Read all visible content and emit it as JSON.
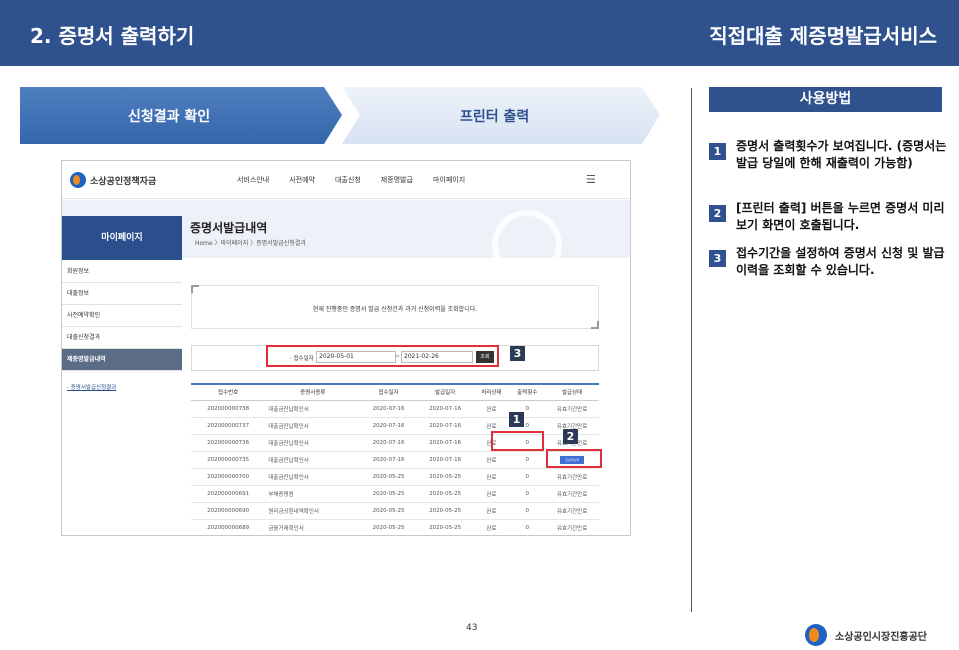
{
  "header": {
    "title_left": "2. 증명서 출력하기",
    "title_right": "직접대출 제증명발급서비스"
  },
  "steps": [
    "신청결과 확인",
    "프린터 출력"
  ],
  "howto": {
    "title": "사용방법",
    "tips": [
      {
        "num": "1",
        "text": "증명서 출력횟수가 보여집니다. (증명서는 발급 당일에 한해 재출력이 가능함)"
      },
      {
        "num": "2",
        "text": "[프린터 출력] 버튼을 누르면 증명서 미리보기 화면이 호출됩니다."
      },
      {
        "num": "3",
        "text": "접수기간을 설정하여 증명서 신청 및 발급이력을 조회할 수 있습니다."
      }
    ]
  },
  "site": {
    "logo_text": "소상공인정책자금",
    "nav": [
      "서비스안내",
      "사전예약",
      "대출신청",
      "제증명발급",
      "마이페이지"
    ],
    "page_title": "증명서발급내역",
    "breadcrumb": "Home 〉마이페이지 〉증명서발급신청결과",
    "sidebar_head": "마이페이지",
    "sidebar_items": [
      "회원정보",
      "대출정보",
      "사전예약확인",
      "대출신청결과",
      "제증명발급내역"
    ],
    "sidebar_sub": "- 증명서발급신청결과",
    "notice": "현재 진행중인 증명서 발급 신청건과 과거 신청이력을 조회합니다.",
    "search": {
      "label": "· 접수일자",
      "from": "2020-05-01",
      "sep": "~",
      "to": "2021-02-26",
      "button": "조회"
    },
    "table": {
      "headers": [
        "접수번호",
        "증명서종류",
        "접수일자",
        "발급일자",
        "처리상태",
        "출력횟수",
        "발급상태"
      ],
      "rows": [
        [
          "202000000738",
          "대출금잔납확인서",
          "2020-07-16",
          "2020-07-16",
          "완료",
          "0",
          "유효기간만료"
        ],
        [
          "202000000737",
          "대출금잔납확인서",
          "2020-07-16",
          "2020-07-16",
          "완료",
          "0",
          "유효기간만료"
        ],
        [
          "202000000736",
          "대출금잔납확인서",
          "2020-07-16",
          "2020-07-16",
          "완료",
          "0",
          "유효기간만료"
        ],
        [
          "202000000735",
          "대출금잔납확인서",
          "2020-07-16",
          "2020-07-16",
          "완료",
          "0",
          "프린터출력"
        ],
        [
          "202000000700",
          "대출금잔납확인서",
          "2020-05-25",
          "2020-05-25",
          "완료",
          "0",
          "유효기간만료"
        ],
        [
          "202000000691",
          "부채증명원",
          "2020-05-25",
          "2020-05-25",
          "완료",
          "0",
          "유효기간만료"
        ],
        [
          "202000000690",
          "원리금상환내역확인서",
          "2020-05-25",
          "2020-05-25",
          "완료",
          "0",
          "유효기간만료"
        ],
        [
          "202000000689",
          "금융거래확인서",
          "2020-05-25",
          "2020-05-25",
          "완료",
          "0",
          "유효기간만료"
        ]
      ]
    }
  },
  "callouts": [
    "1",
    "2",
    "3"
  ],
  "page_number": "43",
  "footer_org": "소상공인시장진흥공단",
  "colors": {
    "primary": "#2f528f",
    "highlight": "#e0303a",
    "print_button": "#3d6fd6"
  }
}
